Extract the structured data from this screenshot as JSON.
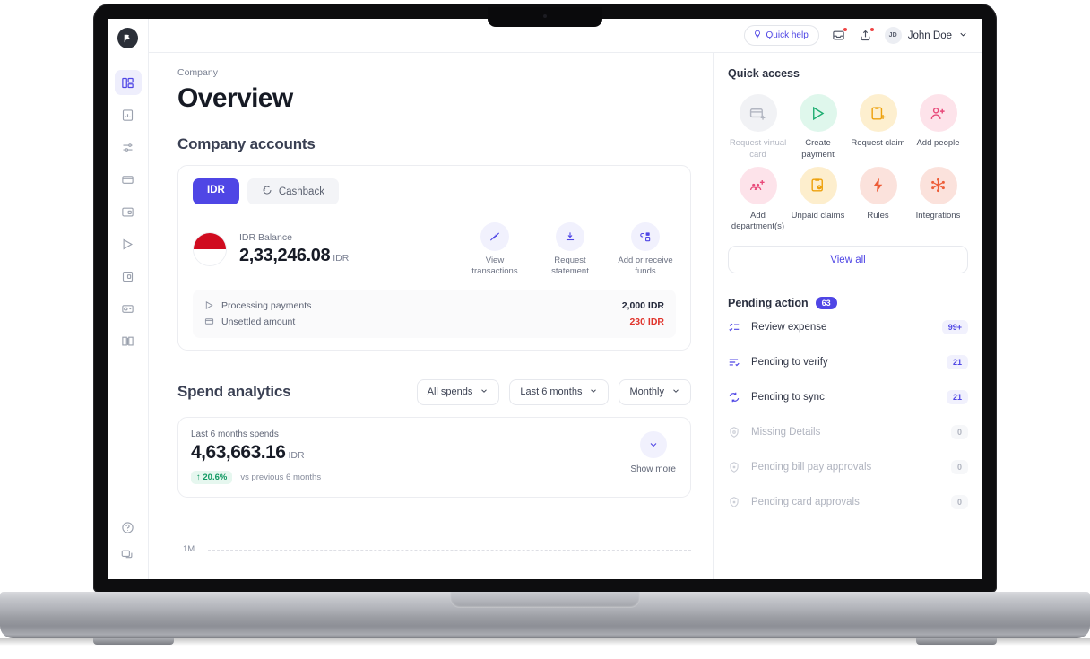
{
  "topbar": {
    "quick_help": "Quick help",
    "inbox_icon": "inbox-icon",
    "upload_icon": "upload-icon",
    "avatar_initials": "JD",
    "user_name": "John Doe"
  },
  "sidebar": {
    "logo": "volopay-logo",
    "items": [
      {
        "icon": "dashboard-icon",
        "active": true
      },
      {
        "icon": "analytics-icon",
        "active": false
      },
      {
        "icon": "sliders-icon",
        "active": false
      },
      {
        "icon": "card-icon",
        "active": false
      },
      {
        "icon": "wallet-icon",
        "active": false
      },
      {
        "icon": "send-icon",
        "active": false
      },
      {
        "icon": "receipt-icon",
        "active": false
      },
      {
        "icon": "bill-icon",
        "active": false
      },
      {
        "icon": "ledger-icon",
        "active": false
      }
    ],
    "bottom_items": [
      {
        "icon": "help-circle-icon"
      },
      {
        "icon": "chat-icon"
      }
    ]
  },
  "main": {
    "breadcrumb": "Company",
    "page_title": "Overview",
    "accounts_section_title": "Company accounts",
    "tabs": [
      {
        "label": "IDR",
        "active": true
      },
      {
        "label": "Cashback",
        "active": false,
        "icon": "cashback-icon"
      }
    ],
    "balance": {
      "flag": "indonesia-flag",
      "label": "IDR Balance",
      "amount": "2,33,246.08",
      "currency": "IDR"
    },
    "actions": [
      {
        "label": "View transactions",
        "icon": "transactions-icon"
      },
      {
        "label": "Request statement",
        "icon": "download-icon"
      },
      {
        "label": "Add or receive funds",
        "icon": "transfer-icon"
      }
    ],
    "sub_rows": [
      {
        "icon": "send-icon",
        "label": "Processing payments",
        "value": "2,000 IDR",
        "red": false
      },
      {
        "icon": "card-icon",
        "label": "Unsettled amount",
        "value": "230 IDR",
        "red": true
      }
    ],
    "analytics": {
      "title": "Spend analytics",
      "filters": [
        {
          "label": "All spends"
        },
        {
          "label": "Last 6 months"
        },
        {
          "label": "Monthly"
        }
      ],
      "summary_label": "Last 6 months spends",
      "summary_amount": "4,63,663.16",
      "summary_currency": "IDR",
      "delta": "20.6%",
      "delta_direction": "up",
      "delta_note": "vs previous 6 months",
      "show_more": "Show more"
    }
  },
  "chart_data": {
    "type": "bar",
    "title": "Spend analytics",
    "categories": [],
    "values": [],
    "ylabel": "",
    "xlabel": "",
    "tick_labels": [
      "1M"
    ],
    "grid": true,
    "legend": "none",
    "note": "Chart is clipped at the bottom of the viewport; only the 1M y-axis tick and its dashed gridline are visible."
  },
  "right": {
    "quick_access_title": "Quick access",
    "quick_access": [
      {
        "label": "Request virtual card",
        "icon": "virtual-card-icon",
        "bg": "#f1f2f5",
        "fg": "#b3b7c2",
        "dim": true
      },
      {
        "label": "Create payment",
        "icon": "send-icon",
        "bg": "#dff7ec",
        "fg": "#1fae72",
        "dim": false
      },
      {
        "label": "Request claim",
        "icon": "claim-icon",
        "bg": "#fdefcf",
        "fg": "#eda10c",
        "dim": false
      },
      {
        "label": "Add people",
        "icon": "add-person-icon",
        "bg": "#fde3ea",
        "fg": "#e84a7a",
        "dim": false
      },
      {
        "label": "Add department(s)",
        "icon": "add-department-icon",
        "bg": "#fde3ea",
        "fg": "#e84a7a",
        "dim": false
      },
      {
        "label": "Unpaid claims",
        "icon": "unpaid-claim-icon",
        "bg": "#fdeecd",
        "fg": "#eda10c",
        "dim": false
      },
      {
        "label": "Rules",
        "icon": "bolt-icon",
        "bg": "#fbe2dc",
        "fg": "#ed5c37",
        "dim": false
      },
      {
        "label": "Integrations",
        "icon": "integrations-icon",
        "bg": "#fbe2dc",
        "fg": "#ed5c37",
        "dim": false
      }
    ],
    "view_all": "View all",
    "pending_title": "Pending action",
    "pending_count": "63",
    "pending_rows": [
      {
        "label": "Review expense",
        "value": "99+",
        "icon": "checklist-icon",
        "dim": false
      },
      {
        "label": "Pending to verify",
        "value": "21",
        "icon": "verify-icon",
        "dim": false
      },
      {
        "label": "Pending to sync",
        "value": "21",
        "icon": "sync-icon",
        "dim": false
      },
      {
        "label": "Missing Details",
        "value": "0",
        "icon": "shield-icon",
        "dim": true
      },
      {
        "label": "Pending bill pay approvals",
        "value": "0",
        "icon": "shield-icon",
        "dim": true
      },
      {
        "label": "Pending card approvals",
        "value": "0",
        "icon": "shield-icon",
        "dim": true
      }
    ]
  },
  "colors": {
    "accent": "#4f46e5",
    "danger": "#e0342c",
    "success": "#129a63",
    "text": "#171b26"
  }
}
